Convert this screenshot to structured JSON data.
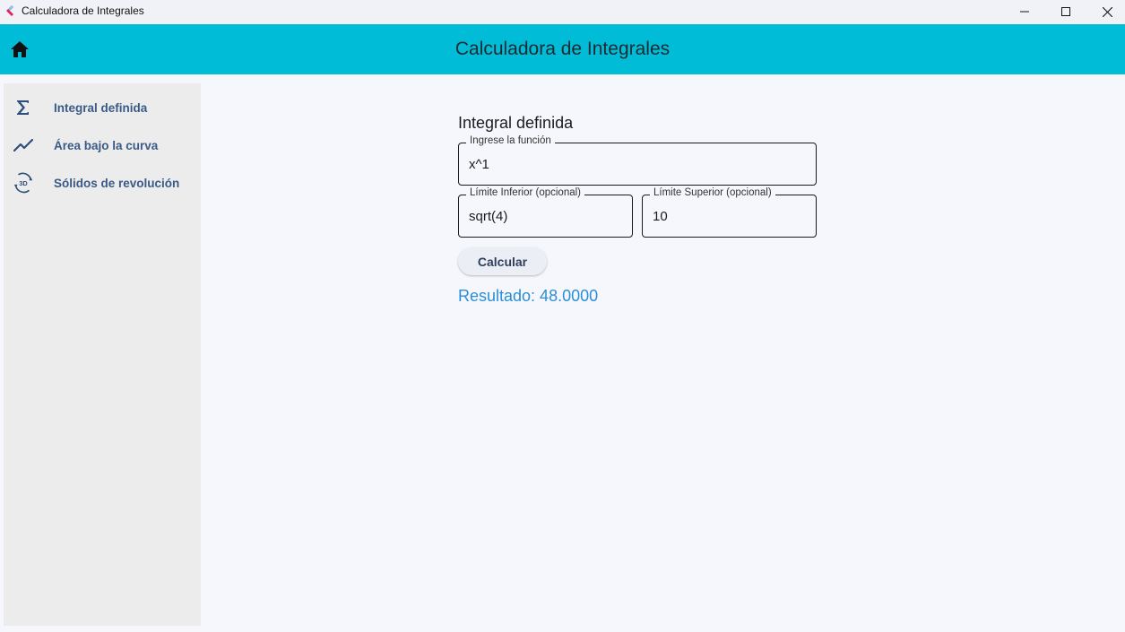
{
  "window": {
    "title": "Calculadora de Integrales",
    "icon": "app-logo-icon"
  },
  "appbar": {
    "title": "Calculadora de Integrales",
    "home_icon": "home-icon",
    "color": "#01bcd6"
  },
  "sidebar": {
    "items": [
      {
        "label": "Integral definida",
        "icon": "sigma-icon"
      },
      {
        "label": "Área bajo la curva",
        "icon": "trending-line-icon"
      },
      {
        "label": "Sólidos de revolución",
        "icon": "3d-rotation-icon"
      }
    ]
  },
  "main": {
    "title": "Integral definida",
    "function_field": {
      "label": "Ingrese la función",
      "value": "x^1"
    },
    "lower_field": {
      "label": "Límite Inferior (opcional)",
      "value": "sqrt(4)"
    },
    "upper_field": {
      "label": "Límite Superior (opcional)",
      "value": "10"
    },
    "calculate_label": "Calcular",
    "result": "Resultado: 48.0000",
    "result_color": "#2a8fd6"
  }
}
